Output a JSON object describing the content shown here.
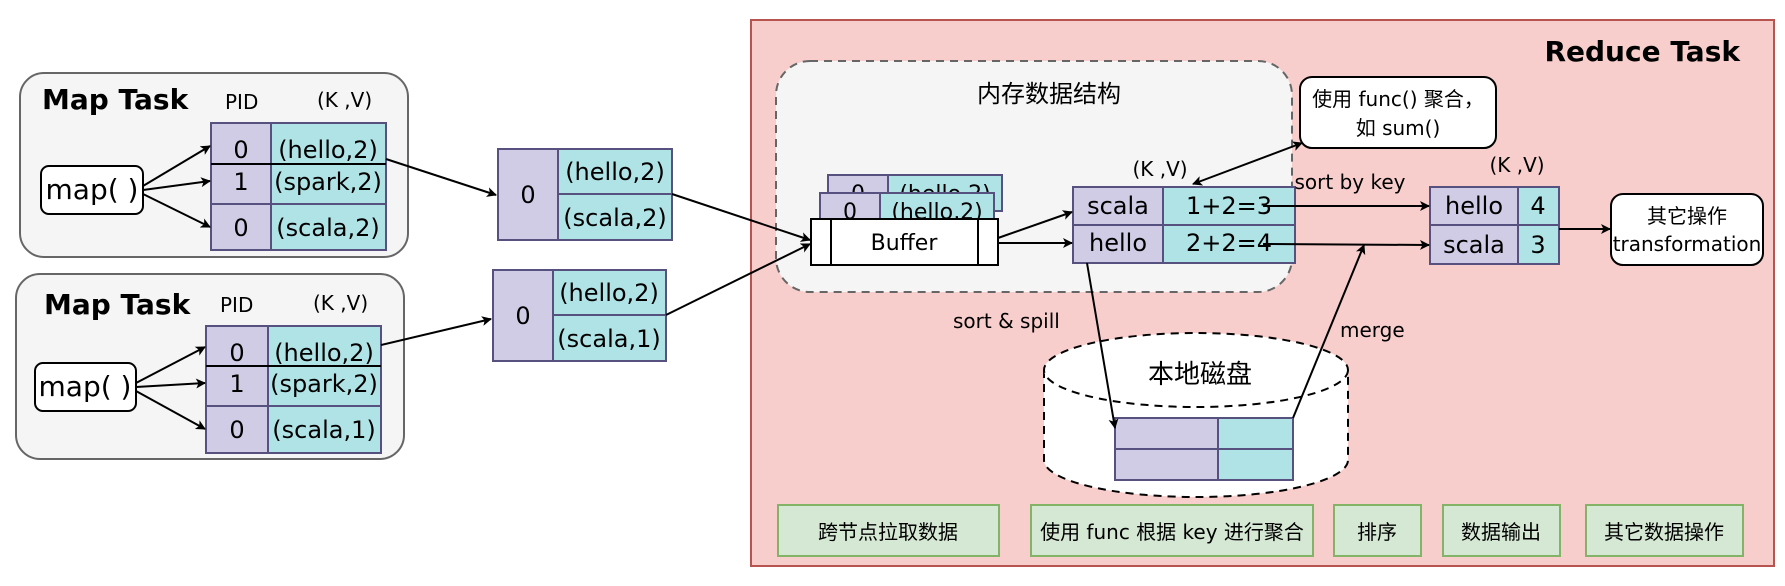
{
  "colors": {
    "purple_cell": "#d0cce6",
    "cyan_cell": "#b0e3e6",
    "cell_stroke": "#56517e",
    "reduce_fill": "#f8cecc",
    "reduce_stroke": "#b85450",
    "green_fill": "#d5e8d4",
    "green_stroke": "#82b366",
    "map_fill": "#f5f5f5",
    "map_stroke": "#666666"
  },
  "map_tasks": [
    {
      "title": "Map Task",
      "pid_label": "PID",
      "kv_label": "(K ,V)",
      "func_label": "map( )",
      "rows": [
        {
          "pid": "0",
          "kv": "(hello,2)"
        },
        {
          "pid": "1",
          "kv": "(spark,2)"
        },
        {
          "pid": "0",
          "kv": "(scala,2)"
        }
      ]
    },
    {
      "title": "Map Task",
      "pid_label": "PID",
      "kv_label": "(K ,V)",
      "func_label": "map( )",
      "rows": [
        {
          "pid": "0",
          "kv": "(hello,2)"
        },
        {
          "pid": "1",
          "kv": "(spark,2)"
        },
        {
          "pid": "0",
          "kv": "(scala,1)"
        }
      ]
    }
  ],
  "partitions": [
    {
      "pid": "0",
      "items": [
        "(hello,2)",
        "(scala,2)"
      ]
    },
    {
      "pid": "0",
      "items": [
        "(hello,2)",
        "(scala,1)"
      ]
    }
  ],
  "reduce": {
    "title": "Reduce Task",
    "memory_label": "内存数据结构",
    "buffer_label": "Buffer",
    "stack_back": {
      "pid": "0",
      "kv": "(hello,2)"
    },
    "stack_mid": {
      "pid": "0",
      "kv": "(hello,2)"
    },
    "kv_label": "(K ,V)",
    "agg_table": [
      {
        "key": "scala",
        "value": "1+2=3"
      },
      {
        "key": "hello",
        "value": "2+2=4"
      }
    ],
    "agg_note": "使用 func() 聚合，\n如 sum()",
    "sort_by_key": "sort by key",
    "sorted_kv_label": "(K ,V)",
    "sorted_table": [
      {
        "key": "hello",
        "value": "4"
      },
      {
        "key": "scala",
        "value": "3"
      }
    ],
    "other_ops": "其它操作\ntransformation",
    "sort_spill": "sort & spill",
    "merge": "merge",
    "disk_label": "本地磁盘",
    "stages": [
      "跨节点拉取数据",
      "使用 func 根据 key 进行聚合",
      "排序",
      "数据输出",
      "其它数据操作"
    ]
  }
}
